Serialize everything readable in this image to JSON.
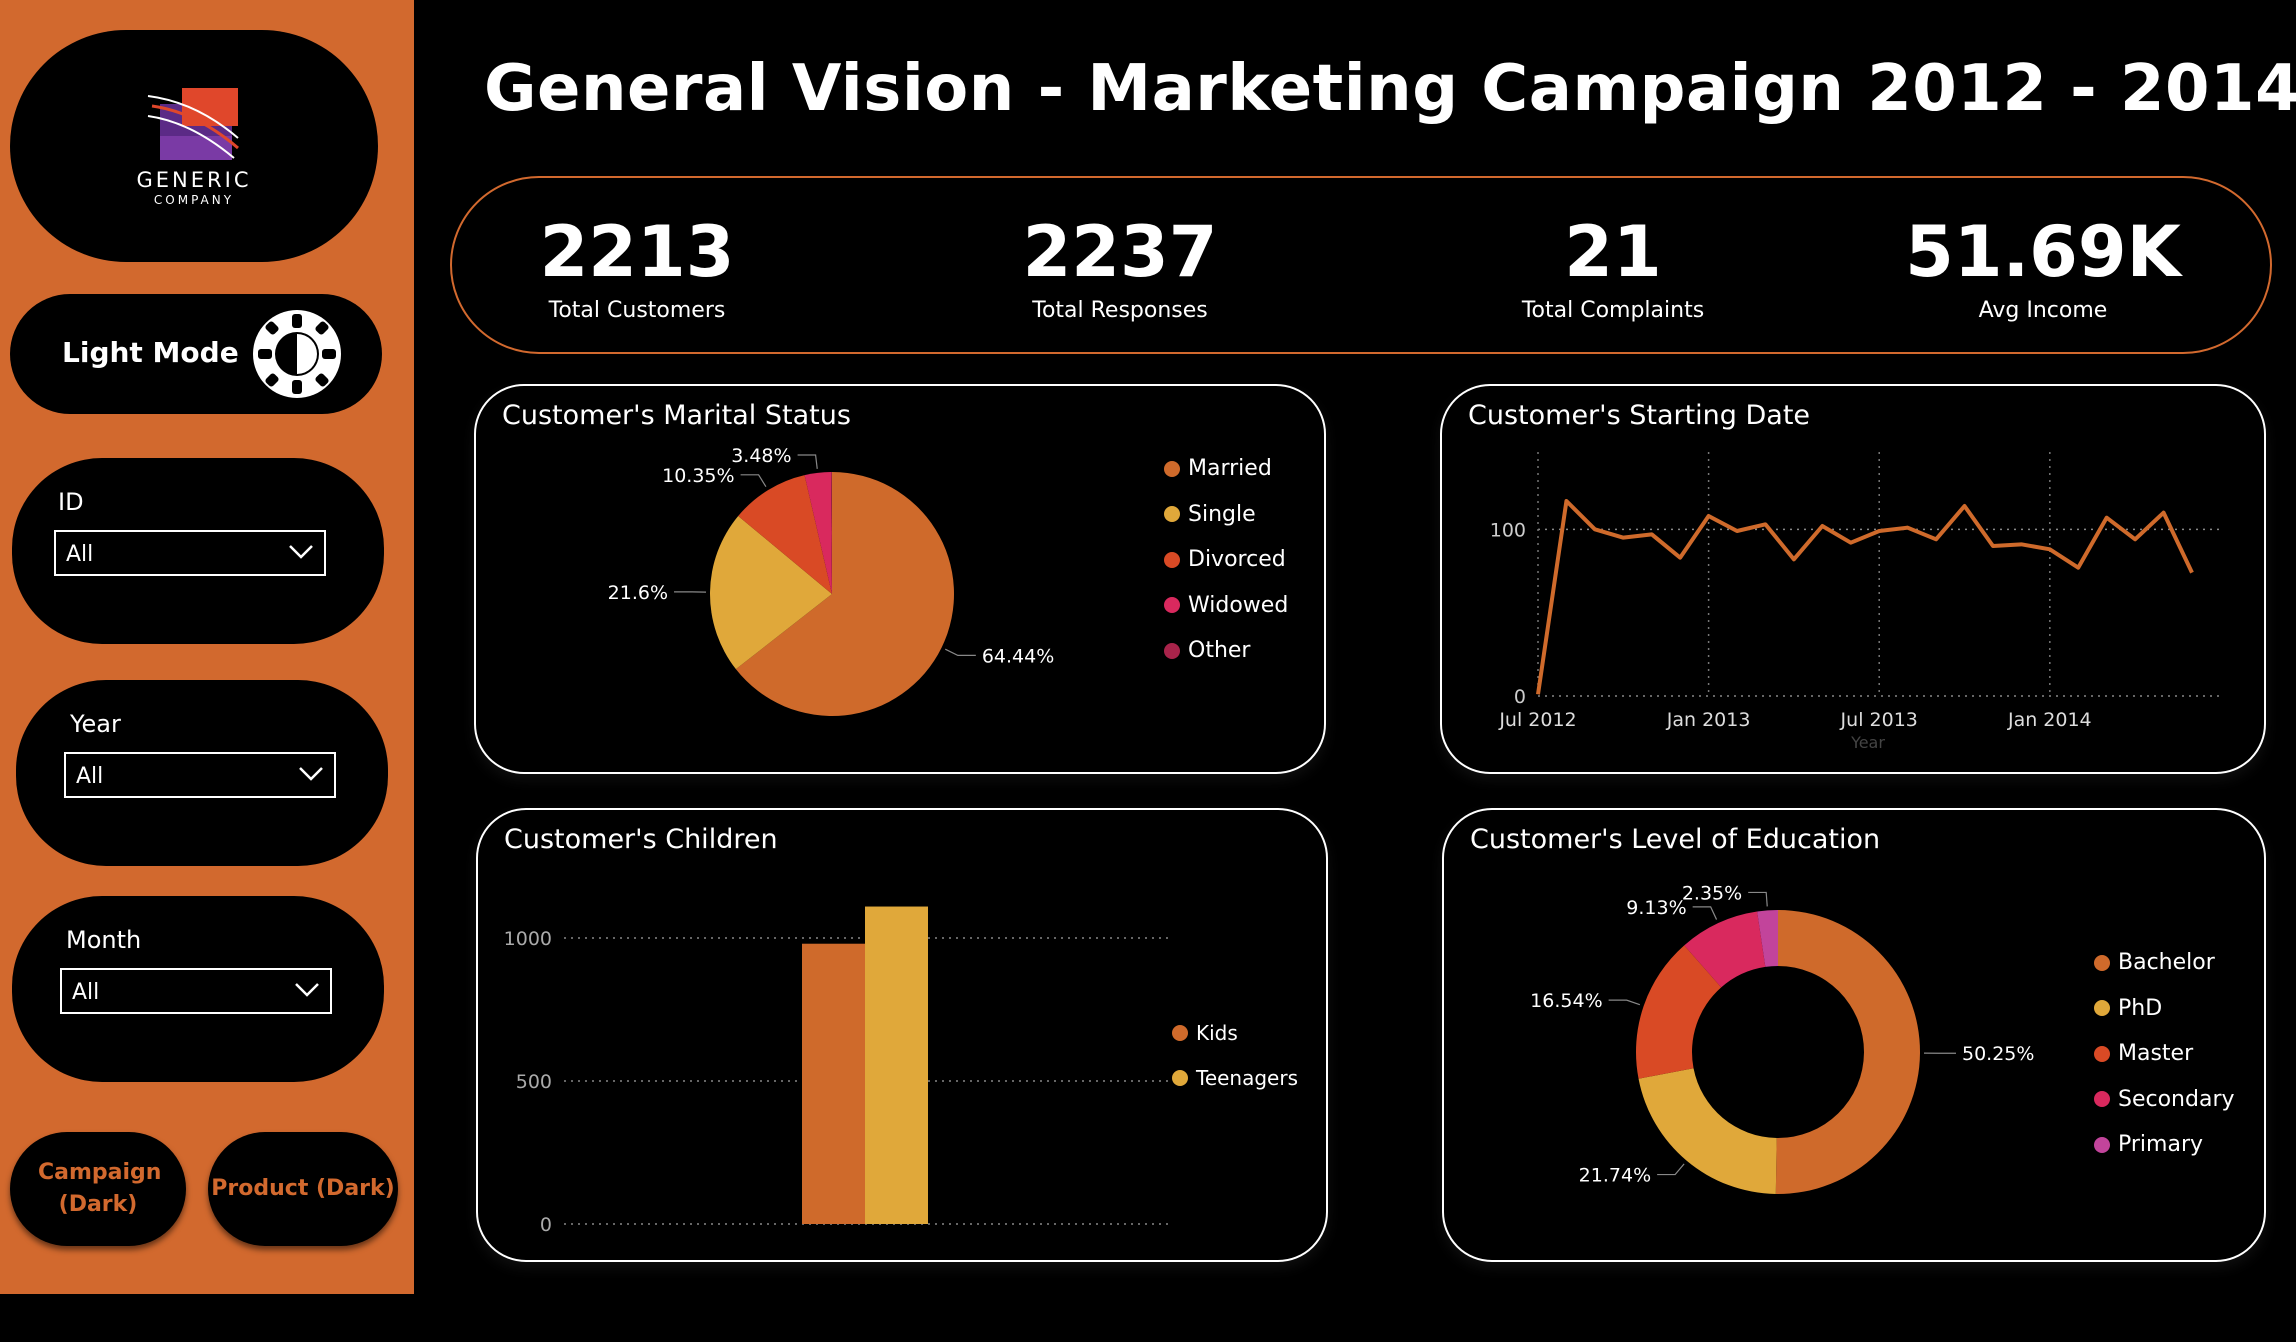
{
  "app": {
    "title": "General Vision - Marketing Campaign 2012 - 2014",
    "logo": {
      "line1": "GENERIC",
      "line2": "COMPANY"
    }
  },
  "sidebar": {
    "mode_toggle": {
      "label": "Light Mode",
      "icon": "half-moon-gear-icon"
    },
    "filters": [
      {
        "label": "ID",
        "value": "All"
      },
      {
        "label": "Year",
        "value": "All"
      },
      {
        "label": "Month",
        "value": "All"
      }
    ],
    "nav": {
      "campaign_label": "Campaign (Dark)",
      "product_label": "Product (Dark)"
    }
  },
  "kpis": [
    {
      "value": "2213",
      "label": "Total Customers"
    },
    {
      "value": "2237",
      "label": "Total Responses"
    },
    {
      "value": "21",
      "label": "Total Complaints"
    },
    {
      "value": "51.69K",
      "label": "Avg Income"
    }
  ],
  "colors": {
    "accent": "#d2692e",
    "orange": "#cf6a2b",
    "yellow": "#e0a83a",
    "red": "#d94a25",
    "crimson": "#d9295e",
    "dark_red": "#a8234a",
    "pink": "#c2449b"
  },
  "chart_data": [
    {
      "type": "pie",
      "title": "Customer's Marital Status",
      "categories": [
        "Married",
        "Single",
        "Divorced",
        "Widowed",
        "Other"
      ],
      "values": [
        64.44,
        21.6,
        10.35,
        3.48,
        0.13
      ],
      "labels": [
        "64.44%",
        "21.6%",
        "10.35%",
        "3.48%",
        ""
      ],
      "colors": [
        "#cf6a2b",
        "#e0a83a",
        "#d94a25",
        "#d9295e",
        "#a8234a"
      ],
      "legend": "right"
    },
    {
      "type": "line",
      "title": "Customer's Starting Date",
      "xlabel": "Year",
      "ylabel": "",
      "x_ticks": [
        "Jul 2012",
        "Jan 2013",
        "Jul 2013",
        "Jan 2014"
      ],
      "y_ticks": [
        "0",
        "100"
      ],
      "ylim": [
        0,
        150
      ],
      "x": [
        "2012-07",
        "2012-08",
        "2012-09",
        "2012-10",
        "2012-11",
        "2012-12",
        "2013-01",
        "2013-02",
        "2013-03",
        "2013-04",
        "2013-05",
        "2013-06",
        "2013-07",
        "2013-08",
        "2013-09",
        "2013-10",
        "2013-11",
        "2013-12",
        "2014-01",
        "2014-02",
        "2014-03",
        "2014-04",
        "2014-05",
        "2014-06"
      ],
      "values": [
        1,
        117,
        100,
        95,
        97,
        83,
        108,
        99,
        103,
        82,
        102,
        92,
        99,
        101,
        94,
        114,
        90,
        91,
        88,
        77,
        107,
        94,
        110,
        74
      ],
      "color": "#cf6a2b",
      "grid": true
    },
    {
      "type": "bar",
      "title": "Customer's Children",
      "categories": [
        ""
      ],
      "series": [
        {
          "name": "Kids",
          "values": [
            980
          ],
          "color": "#cf6a2b"
        },
        {
          "name": "Teenagers",
          "values": [
            1110
          ],
          "color": "#e0a83a"
        }
      ],
      "y_ticks": [
        "0",
        "500",
        "1000"
      ],
      "ylim": [
        0,
        1000
      ],
      "legend": "right"
    },
    {
      "type": "pie",
      "title": "Customer's Level of Education",
      "categories": [
        "Bachelor",
        "PhD",
        "Master",
        "Secondary",
        "Primary"
      ],
      "values": [
        50.25,
        21.74,
        16.54,
        9.13,
        2.35
      ],
      "labels": [
        "50.25%",
        "21.74%",
        "16.54%",
        "9.13%",
        "2.35%"
      ],
      "colors": [
        "#cf6a2b",
        "#e0a83a",
        "#d94a25",
        "#d9295e",
        "#c2449b"
      ],
      "legend": "right",
      "donut": true
    }
  ]
}
